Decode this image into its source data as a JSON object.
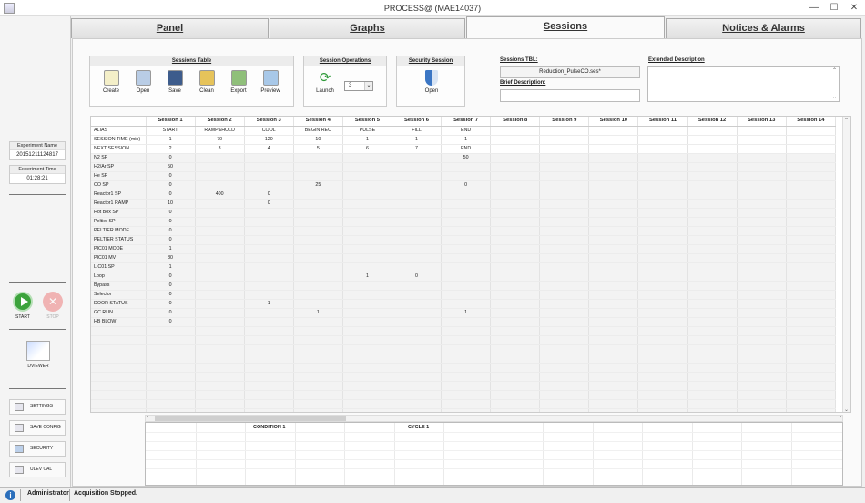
{
  "window": {
    "title": "PROCESS@ (MAE14037)",
    "min": "—",
    "max": "☐",
    "close": "✕"
  },
  "tabs": [
    {
      "label": "Panel"
    },
    {
      "label": "Graphs"
    },
    {
      "label": "Sessions"
    },
    {
      "label": "Notices & Alarms"
    }
  ],
  "sidebar": {
    "experiment_name_label": "Experiment Name",
    "experiment_name_value": "20151211124817",
    "experiment_time_label": "Experiment Time",
    "experiment_time_value": "01:28:21",
    "start_label": "START",
    "stop_label": "STOP",
    "viewer_label": "DVIEWER",
    "buttons": [
      {
        "label": "SETTINGS",
        "icon": "wrench-icon"
      },
      {
        "label": "SAVE CONFIG",
        "icon": "save-icon"
      },
      {
        "label": "SECURITY",
        "icon": "shield-icon"
      },
      {
        "label": "ULEV CAL",
        "icon": "calibration-icon"
      }
    ]
  },
  "toolbar": {
    "sessions_table_title": "Sessions Table",
    "tools": [
      {
        "label": "Create",
        "icon": "new-file-icon",
        "color": "#f4efc8"
      },
      {
        "label": "Open",
        "icon": "open-icon",
        "color": "#b9cde6"
      },
      {
        "label": "Save",
        "icon": "save-icon",
        "color": "#3d5c8c"
      },
      {
        "label": "Clean",
        "icon": "broom-icon",
        "color": "#e6c35a"
      },
      {
        "label": "Export",
        "icon": "export-icon",
        "color": "#8fbf7a"
      },
      {
        "label": "Preview",
        "icon": "preview-icon",
        "color": "#a8c8e8"
      }
    ],
    "session_ops_title": "Session Operations",
    "launch_label": "Launch",
    "launch_value": "3",
    "security_title": "Security Session",
    "security_open_label": "Open"
  },
  "details": {
    "sessions_tbl_label": "Sessions TBL:",
    "sessions_tbl_value": "Reduction_PulseCO.ses*",
    "brief_label": "Brief Description:",
    "brief_value": "",
    "extended_label": "Extended Description",
    "extended_value": ""
  },
  "grid": {
    "columns": [
      "",
      "Session 1",
      "Session 2",
      "Session 3",
      "Session 4",
      "Session 5",
      "Session 6",
      "Session 7",
      "Session 8",
      "Session 9",
      "Session 10",
      "Session 11",
      "Session 12",
      "Session 13",
      "Session 14"
    ],
    "rows": [
      [
        "ALIAS",
        "START",
        "RAMP&HOLD",
        "COOL",
        "BEGIN REC",
        "PULSE",
        "FILL",
        "END"
      ],
      [
        "SESSION TIME (min)",
        "1",
        "70",
        "120",
        "10",
        "1",
        "1",
        "1"
      ],
      [
        "NEXT SESSION",
        "2",
        "3",
        "4",
        "5",
        "6",
        "7",
        "END"
      ],
      [
        "N2 SP",
        "0",
        "",
        "",
        "",
        "",
        "",
        "50"
      ],
      [
        "H2/Ar SP",
        "50",
        "",
        "",
        "",
        "",
        "",
        ""
      ],
      [
        "He SP",
        "0",
        "",
        "",
        "",
        "",
        "",
        ""
      ],
      [
        "CO SP",
        "0",
        "",
        "",
        "25",
        "",
        "",
        "0"
      ],
      [
        "Reactor1 SP",
        "0",
        "400",
        "0",
        "",
        "",
        "",
        ""
      ],
      [
        "Reactor1 RAMP",
        "10",
        "",
        "0",
        "",
        "",
        "",
        ""
      ],
      [
        "Hot Box SP",
        "0",
        "",
        "",
        "",
        "",
        "",
        ""
      ],
      [
        "Peltier SP",
        "0",
        "",
        "",
        "",
        "",
        "",
        ""
      ],
      [
        "PELTIER MODE",
        "0",
        "",
        "",
        "",
        "",
        "",
        ""
      ],
      [
        "PELTIER STATUS",
        "0",
        "",
        "",
        "",
        "",
        "",
        ""
      ],
      [
        "PIC01 MODE",
        "1",
        "",
        "",
        "",
        "",
        "",
        ""
      ],
      [
        "PIC01 MV",
        "80",
        "",
        "",
        "",
        "",
        "",
        ""
      ],
      [
        "LIC01 SP",
        "1",
        "",
        "",
        "",
        "",
        "",
        ""
      ],
      [
        "Loop",
        "0",
        "",
        "",
        "",
        "1",
        "0",
        ""
      ],
      [
        "Bypass",
        "0",
        "",
        "",
        "",
        "",
        "",
        ""
      ],
      [
        "Selector",
        "0",
        "",
        "",
        "",
        "",
        "",
        ""
      ],
      [
        "DOOR STATUS",
        "0",
        "",
        "1",
        "",
        "",
        "",
        ""
      ],
      [
        "GC RUN",
        "0",
        "",
        "",
        "1",
        "",
        "",
        "1"
      ],
      [
        "HB BLOW",
        "0",
        "",
        "",
        "",
        "",
        "",
        ""
      ]
    ],
    "empty_rows": 10
  },
  "lower": {
    "col1": "CONDITION 1",
    "col2": "CYCLE 1"
  },
  "statusbar": {
    "user": "Administrator",
    "message": "Acquisition Stopped."
  }
}
